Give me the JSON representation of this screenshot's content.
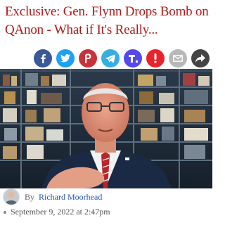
{
  "article": {
    "headline": "Exclusive: Gen. Flynn Drops Bomb on QAnon - What if It's Really...",
    "author_prefix": "By",
    "author_name": "Richard Moorhead",
    "date": "September 9, 2022 at 2:47pm"
  },
  "share_buttons": [
    {
      "name": "facebook",
      "icon": "facebook-icon",
      "color": "#3b5998"
    },
    {
      "name": "twitter",
      "icon": "twitter-icon",
      "color": "#1da1f2"
    },
    {
      "name": "parler",
      "icon": "parler-icon",
      "color": "#c9323b"
    },
    {
      "name": "telegram",
      "icon": "telegram-icon",
      "color": "#37aee2"
    },
    {
      "name": "truth-social",
      "icon": "truth-social-icon",
      "color": "#5448ee"
    },
    {
      "name": "gettr",
      "icon": "gettr-icon",
      "color": "#e8232b"
    },
    {
      "name": "email",
      "icon": "email-icon",
      "color": "#b8b8b8"
    },
    {
      "name": "share",
      "icon": "share-icon",
      "color": "#444444"
    }
  ],
  "colors": {
    "headline": "#b01919",
    "author_link": "#2a56b8"
  }
}
